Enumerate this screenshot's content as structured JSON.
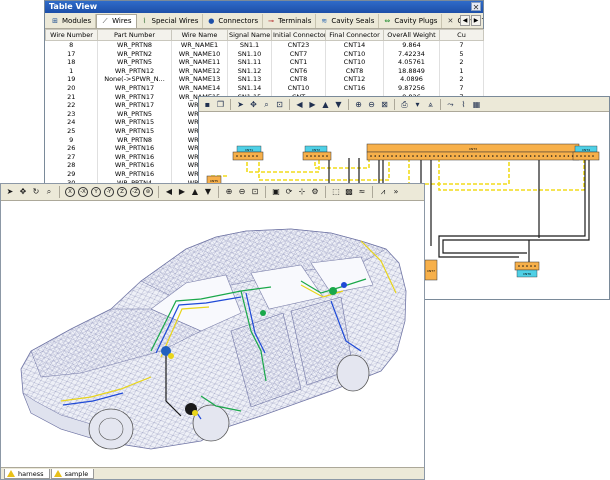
{
  "table_view": {
    "title": "Table View",
    "close_glyph": "✕",
    "tabs": [
      {
        "label": "Modules",
        "icon": "modules-icon",
        "glyph": "⊞"
      },
      {
        "label": "Wires",
        "icon": "wire-icon",
        "glyph": "⟋"
      },
      {
        "label": "Special Wires",
        "icon": "special-wires-icon",
        "glyph": "⌇"
      },
      {
        "label": "Connectors",
        "icon": "connector-icon",
        "glyph": "●"
      },
      {
        "label": "Terminals",
        "icon": "terminal-icon",
        "glyph": "⊸"
      },
      {
        "label": "Cavity Seals",
        "icon": "cavity-seal-icon",
        "glyph": "≋"
      },
      {
        "label": "Cavity Plugs",
        "icon": "cavity-plug-icon",
        "glyph": "⇔"
      },
      {
        "label": "Cavity Termina",
        "icon": "cavity-terminal-icon",
        "glyph": "✕"
      }
    ],
    "scroll_left": "◀",
    "scroll_right": "▶",
    "columns": [
      "Wire Number",
      "Part Number",
      "Wire Name",
      "Signal Name",
      "Initial Connector",
      "Final Connector",
      "OverAll Weight",
      "Cu"
    ],
    "rows": [
      [
        "8",
        "WR_PRTN8",
        "WR_NAME1",
        "SN1.1",
        "CNT23",
        "CNT14",
        "9.864",
        "7"
      ],
      [
        "17",
        "WR_PRTN2",
        "WR_NAME10",
        "SN1.10",
        "CNT7",
        "CNT10",
        "7.42234",
        "5"
      ],
      [
        "18",
        "WR_PRTN5",
        "WR_NAME11",
        "SN1.11",
        "CNT1",
        "CNT10",
        "4.05761",
        "2"
      ],
      [
        "1",
        "WR_PRTN12",
        "WR_NAME12",
        "SN1.12",
        "CNT6",
        "CNT8",
        "18.8849",
        "1"
      ],
      [
        "19",
        "None(->SPWR_N...",
        "WR_NAME13",
        "SN1.13",
        "CNT8",
        "CNT12",
        "4.0896",
        "2"
      ],
      [
        "20",
        "WR_PRTN17",
        "WR_NAME14",
        "SN1.14",
        "CNT10",
        "CNT16",
        "9.87256",
        "7"
      ],
      [
        "21",
        "WR_PRTN17",
        "WR_NAME15",
        "SN1.15",
        "CNT",
        "",
        "9.826",
        "7"
      ],
      [
        "22",
        "WR_PRTN17",
        "WR_NA",
        "",
        "",
        "",
        "",
        ""
      ],
      [
        "23",
        "WR_PRTN5",
        "WR_NA",
        "",
        "",
        "",
        "",
        ""
      ],
      [
        "24",
        "WR_PRTN15",
        "WR_NA",
        "",
        "",
        "",
        "",
        ""
      ],
      [
        "25",
        "WR_PRTN15",
        "WR_NA",
        "",
        "",
        "",
        "",
        ""
      ],
      [
        "9",
        "WR_PRTN8",
        "WR_NA",
        "",
        "",
        "",
        "",
        ""
      ],
      [
        "26",
        "WR_PRTN16",
        "WR_NA",
        "",
        "",
        "",
        "",
        ""
      ],
      [
        "27",
        "WR_PRTN16",
        "WR_NA",
        "",
        "",
        "",
        "",
        ""
      ],
      [
        "28",
        "WR_PRTN16",
        "WR_NA",
        "",
        "",
        "",
        "",
        ""
      ],
      [
        "29",
        "WR_PRTN16",
        "WR_NA",
        "",
        "",
        "",
        "",
        ""
      ],
      [
        "30",
        "WR_PRTN4",
        "WR_NA",
        "",
        "",
        "",
        "",
        ""
      ]
    ]
  },
  "schematic_view": {
    "toolbar": [
      "save-icon",
      "copy-icon",
      "select-arrow-icon",
      "move-icon",
      "zoom-icon",
      "zoom-window-icon",
      "arrow-left-icon",
      "arrow-right-icon",
      "arrow-up-icon",
      "arrow-down-icon",
      "zoom-in-icon",
      "zoom-out-icon",
      "fit-icon",
      "print-icon",
      "dropdown-icon",
      "filter-icon",
      "route-icon",
      "wire-tool-icon",
      "grid-icon"
    ],
    "connector_labels": [
      "CNT1",
      "CNT2",
      "CNT3",
      "CNT4",
      "CNT5",
      "CNT6",
      "CNT7"
    ]
  },
  "view3d": {
    "toolbar_icons": [
      "select-arrow-icon",
      "move-icon",
      "rotate-icon",
      "zoom-icon",
      "view-x-icon",
      "view-x-neg-icon",
      "view-y-icon",
      "view-y-neg-icon",
      "view-z-icon",
      "view-z-neg-icon",
      "view-iso-icon",
      "arrow-left-icon",
      "arrow-right-icon",
      "arrow-up-icon",
      "arrow-down-icon",
      "zoom-in-icon",
      "zoom-out-icon",
      "fit-all-icon",
      "display-mode-icon",
      "rotate-axis-icon",
      "axis-icon",
      "settings-icon",
      "select-part-icon",
      "harness-color-icon",
      "wire-highlight-icon",
      "graph-icon",
      "more-icon"
    ],
    "circle_labels": [
      "X",
      "-X",
      "Y",
      "-Y",
      "Z",
      "-Z",
      "⊛"
    ],
    "tabs": [
      {
        "label": "harness",
        "icon": "warning-icon"
      },
      {
        "label": "sample",
        "icon": "warning-icon"
      }
    ]
  },
  "colors": {
    "connector_orange": "#f7b04a",
    "connector_cyan": "#4fd0e6",
    "wire_yellow": "#f2dc1c",
    "wire_black": "#1a1a1a",
    "title_blue": "#1d4fa8"
  }
}
